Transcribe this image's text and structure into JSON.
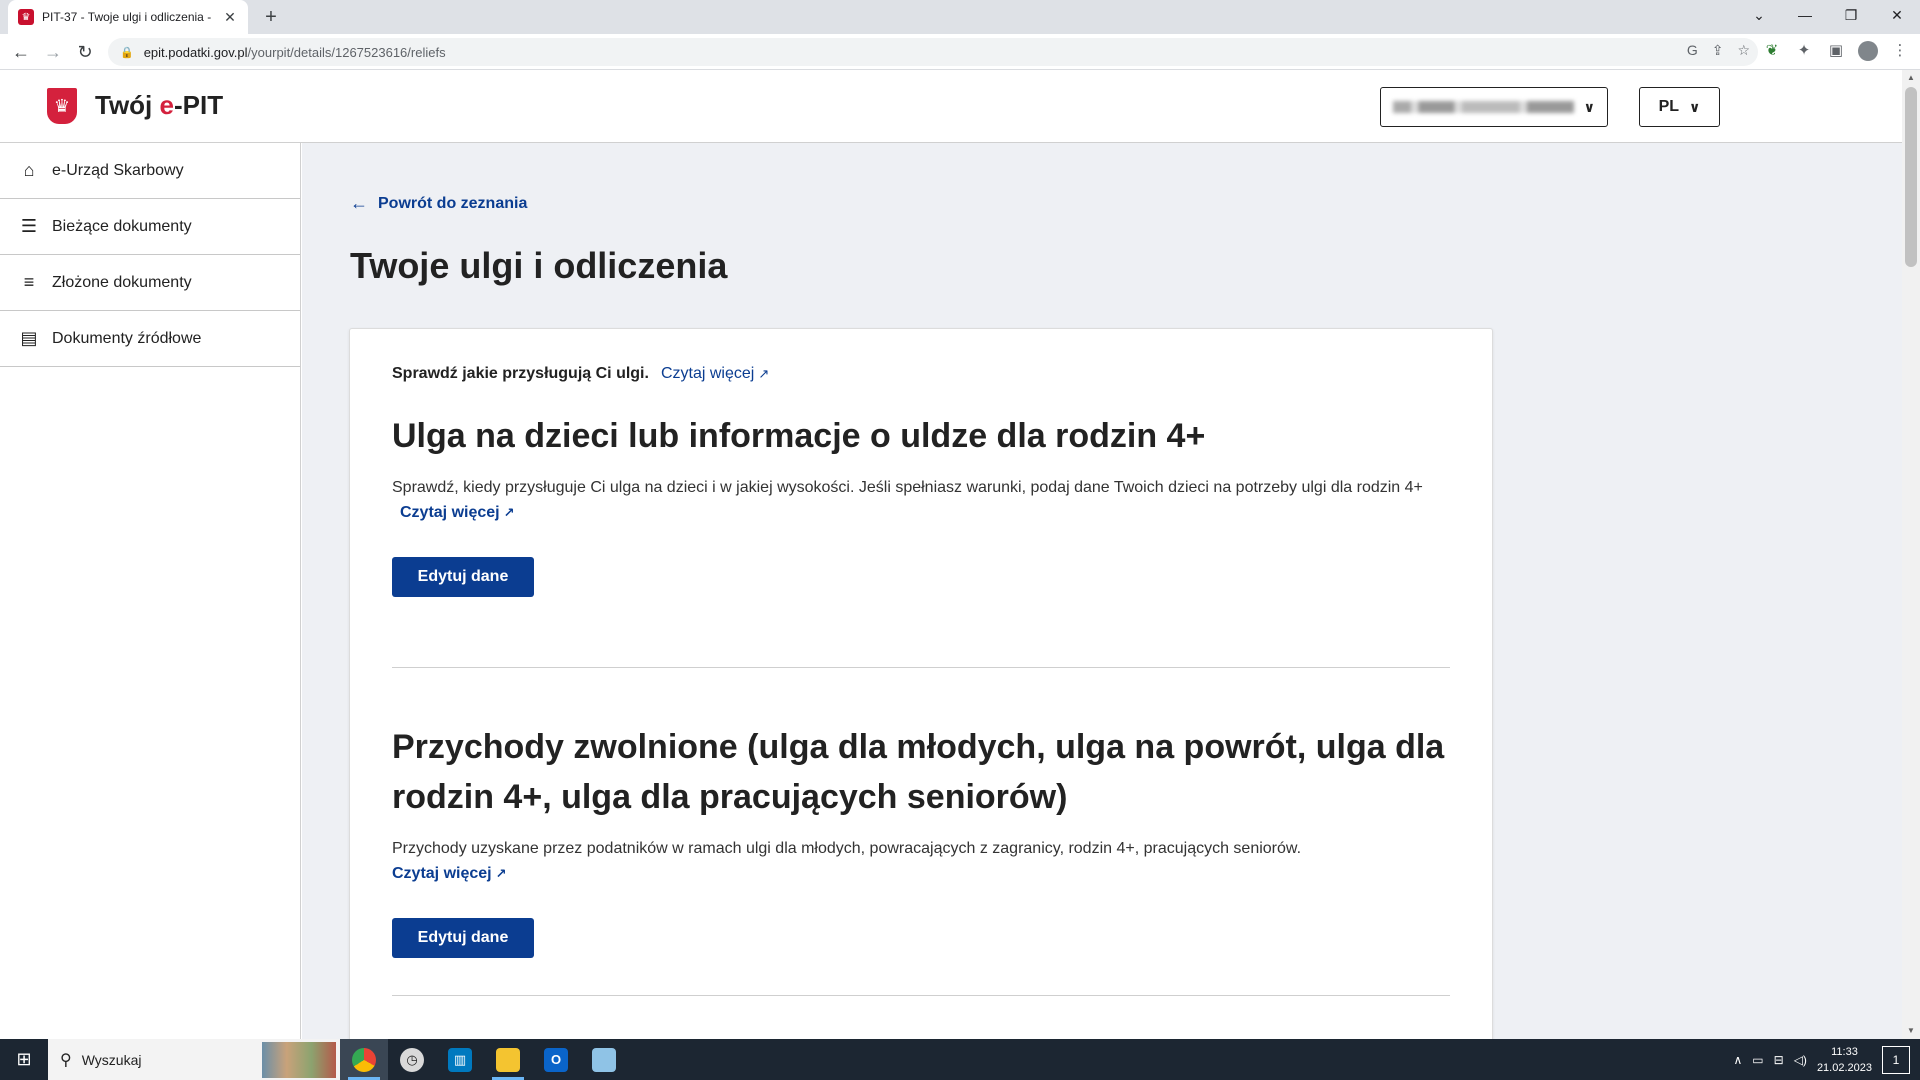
{
  "browser": {
    "tab_title": "PIT-37 - Twoje ulgi i odliczenia -",
    "tab_close": "✕",
    "new_tab": "+",
    "url_host": "epit.podatki.gov.pl",
    "url_path": "/yourpit/details/1267523616/reliefs"
  },
  "header": {
    "logo_prefix": "Twój ",
    "logo_accent": "e",
    "logo_suffix": "-PIT",
    "user_name_redacted": "",
    "language": "PL"
  },
  "sidebar": {
    "items": [
      {
        "label": "e-Urząd Skarbowy",
        "icon": "home-icon"
      },
      {
        "label": "Bieżące dokumenty",
        "icon": "list-add-icon"
      },
      {
        "label": "Złożone dokumenty",
        "icon": "list-check-icon"
      },
      {
        "label": "Dokumenty źródłowe",
        "icon": "document-icon"
      }
    ]
  },
  "main": {
    "back_link": "Powrót do zeznania",
    "title": "Twoje ulgi i odliczenia",
    "intro_text": "Sprawdź jakie przysługują Ci ulgi.",
    "intro_link": "Czytaj więcej",
    "sections": [
      {
        "title": "Ulga na dzieci lub informacje o uldze dla rodzin 4+",
        "description": "Sprawdź, kiedy przysługuje Ci ulga na dzieci i w jakiej wysokości. Jeśli spełniasz warunki, podaj dane Twoich dzieci na potrzeby ulgi dla rodzin 4+",
        "link": "Czytaj więcej",
        "button": "Edytuj dane"
      },
      {
        "title": "Przychody zwolnione (ulga dla młodych, ulga na powrót, ulga dla rodzin 4+, ulga dla pracujących seniorów)",
        "description": "Przychody uzyskane przez podatników w ramach ulgi dla młodych, powracających z zagranicy, rodzin 4+, pracujących seniorów.",
        "link": "Czytaj więcej",
        "button": "Edytuj dane"
      }
    ]
  },
  "taskbar": {
    "search_placeholder": "Wyszukaj",
    "time": "11:33",
    "date": "21.02.2023",
    "notification_count": "1"
  },
  "colors": {
    "primary": "#0b3d91",
    "accent_red": "#d4213d",
    "main_bg": "#eef0f4"
  }
}
